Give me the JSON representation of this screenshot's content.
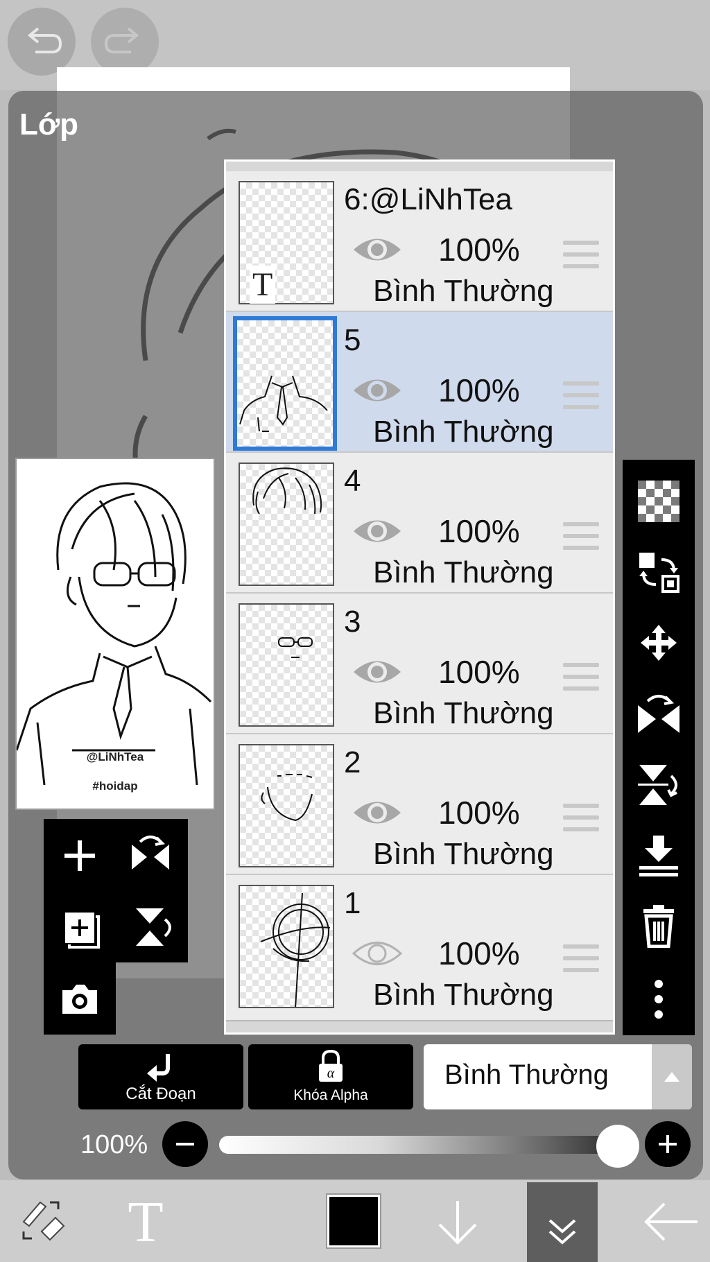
{
  "panel": {
    "title": "Lớp"
  },
  "preview": {
    "line1": "@LiNhTea",
    "line2": "#hoidap"
  },
  "layers": [
    {
      "name": "6:@LiNhTea",
      "opacity": "100%",
      "blend": "Bình Thường",
      "visible": true,
      "selected": false,
      "thumb_glyph": "T"
    },
    {
      "name": "5",
      "opacity": "100%",
      "blend": "Bình Thường",
      "visible": true,
      "selected": true
    },
    {
      "name": "4",
      "opacity": "100%",
      "blend": "Bình Thường",
      "visible": true,
      "selected": false
    },
    {
      "name": "3",
      "opacity": "100%",
      "blend": "Bình Thường",
      "visible": true,
      "selected": false
    },
    {
      "name": "2",
      "opacity": "100%",
      "blend": "Bình Thường",
      "visible": true,
      "selected": false
    },
    {
      "name": "1",
      "opacity": "100%",
      "blend": "Bình Thường",
      "visible": false,
      "selected": false
    }
  ],
  "actions": {
    "clipping_label": "Cắt Đoạn",
    "alpha_lock_label": "Khóa Alpha",
    "blend_mode_value": "Bình Thường"
  },
  "opacity_slider": {
    "label": "100%",
    "value": 1.0
  },
  "colors": {
    "selected_row": "#cfdaec",
    "selected_border": "#2f7ad6",
    "current_color": "#000000"
  },
  "icons": {
    "top": [
      "undo-icon",
      "redo-icon"
    ],
    "left_tools": [
      "add-layer-icon",
      "flip-horizontal-icon",
      "duplicate-layer-icon",
      "flip-vertical-icon",
      "camera-icon"
    ],
    "right_tools": [
      "transparency-icon",
      "swap-layer-icon",
      "move-icon",
      "flip-horizontal-icon",
      "flip-vertical-icon",
      "merge-down-icon",
      "trash-icon",
      "more-icon"
    ],
    "bottom": [
      "brush-eraser-icon",
      "text-icon",
      "color-swatch",
      "down-arrow-icon",
      "collapse-icon",
      "back-icon"
    ]
  }
}
